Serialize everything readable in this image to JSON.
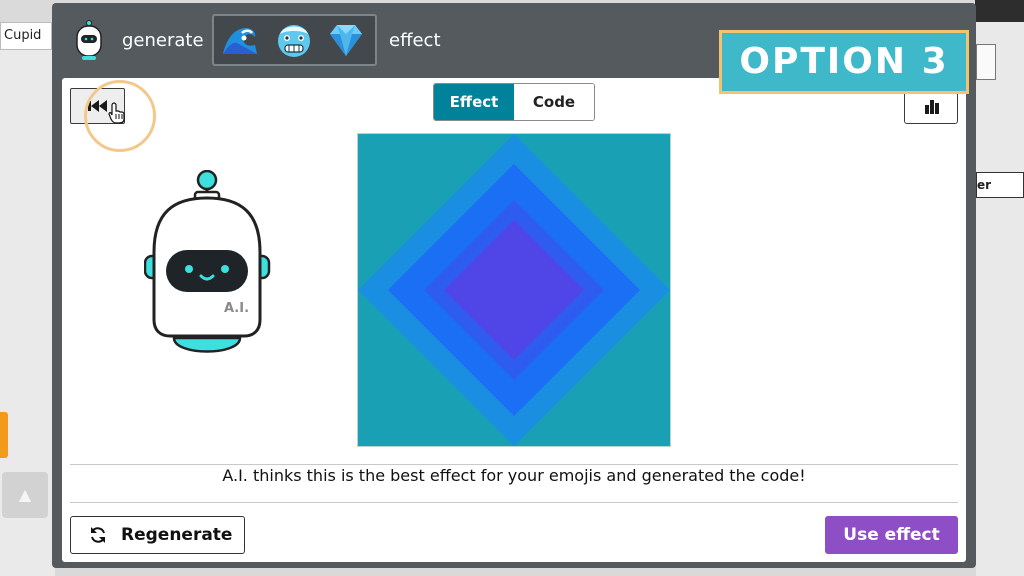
{
  "background_app": {
    "sprite_name": "Cupid",
    "up_arrow": "▲",
    "right_button_fragment": "er"
  },
  "dialog": {
    "title_prefix": "generate",
    "title_suffix": "effect",
    "emojis": [
      {
        "name": "water-wave-emoji",
        "glyph": "🌊"
      },
      {
        "name": "cold-face-emoji",
        "glyph": "🥶"
      },
      {
        "name": "gem-stone-emoji",
        "glyph": "💎"
      }
    ],
    "tabs": [
      {
        "label": "Effect",
        "active": true
      },
      {
        "label": "Code",
        "active": false
      }
    ],
    "robot_label": "A.I.",
    "message": "A.I. thinks this is the best effect for your emojis and generated the code!",
    "regenerate_label": "Regenerate",
    "use_effect_label": "Use effect"
  },
  "overlay": {
    "option_label": "OPTION 3"
  },
  "colors": {
    "dialog_frame": "#545a5e",
    "active_tab": "#00839a",
    "use_effect_button": "#8e4ec6",
    "option_banner": "#3fb8c9",
    "option_banner_border": "#f3c470",
    "robot_accent": "#3ee0df",
    "preview_outer": "#1aa0b5",
    "preview_mid": "#1a6ff4",
    "preview_inner": "#5046e8"
  }
}
